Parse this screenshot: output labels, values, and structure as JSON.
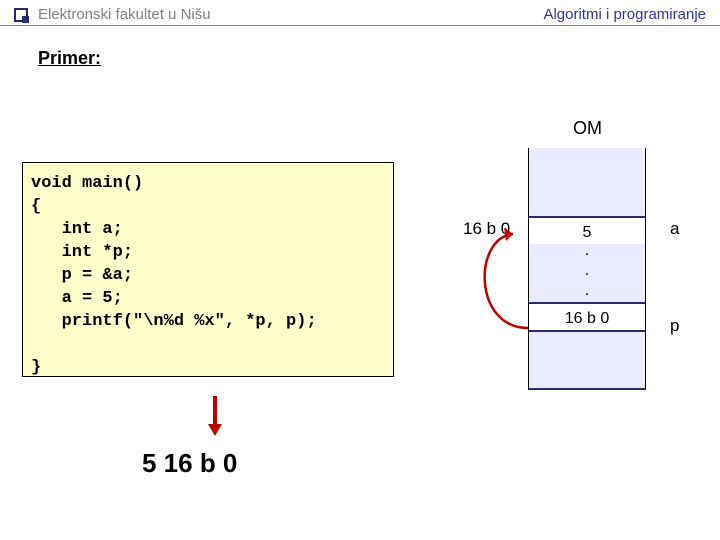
{
  "header": {
    "left": "Elektronski fakultet u Nišu",
    "right": "Algoritmi i programiranje"
  },
  "section_label": "Primer:",
  "om_label": "OM",
  "code": "void main()\n{\n   int a;\n   int *p;\n   p = &a;\n   a = 5;\n   printf(\"\\n%d %x\", *p, p);\n\n}",
  "memory": {
    "addr_label": "16 b 0",
    "cells": [
      "5",
      ".",
      ".",
      ".",
      "16 b 0"
    ],
    "var_a": "a",
    "var_p": "p"
  },
  "output": "5 16 b 0"
}
